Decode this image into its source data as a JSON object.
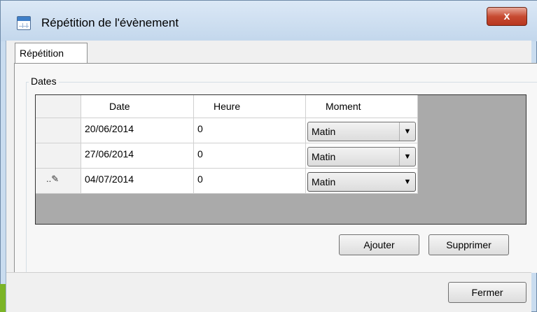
{
  "window": {
    "title": "Répétition de l'évènement",
    "close_label": "x"
  },
  "tabs": [
    {
      "label": "Répétition"
    }
  ],
  "group": {
    "label": "Dates"
  },
  "table": {
    "headers": [
      "Date",
      "Heure",
      "Moment"
    ],
    "rows": [
      {
        "date": "20/06/2014",
        "heure": "0",
        "moment": "Matin"
      },
      {
        "date": "27/06/2014",
        "heure": "0",
        "moment": "Matin"
      },
      {
        "date": "04/07/2014",
        "heure": "0",
        "moment": "Matin",
        "editing": true
      }
    ]
  },
  "buttons": {
    "add": "Ajouter",
    "delete": "Supprimer",
    "close": "Fermer"
  },
  "icons": {
    "app": "calendar-icon",
    "edit_row": "pencil-icon",
    "dropdown": "chevron-down-icon"
  }
}
